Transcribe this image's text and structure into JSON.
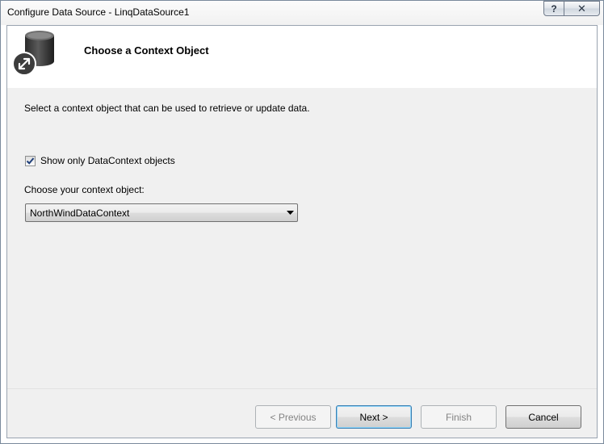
{
  "window": {
    "title": "Configure Data Source - LinqDataSource1",
    "help_glyph": "?",
    "close_glyph": "✕"
  },
  "header": {
    "title": "Choose a Context Object",
    "icon": "database-configure-icon"
  },
  "main": {
    "description": "Select a context object that can be used to retrieve or update data.",
    "checkbox": {
      "label": "Show only DataContext objects",
      "checked": true
    },
    "combo_label": "Choose your context object:",
    "combo": {
      "selected": "NorthWindDataContext"
    }
  },
  "footer": {
    "previous_label": "< Previous",
    "next_label": "Next >",
    "finish_label": "Finish",
    "cancel_label": "Cancel"
  }
}
